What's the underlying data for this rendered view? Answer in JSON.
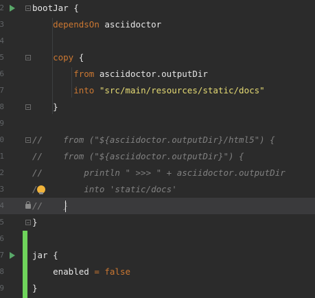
{
  "editor": {
    "lines": [
      {
        "num": "2",
        "parts": [
          {
            "cls": "plain",
            "text": "bootJar {"
          }
        ]
      },
      {
        "num": "3",
        "parts": [
          {
            "cls": "plain",
            "text": "    "
          },
          {
            "cls": "kw",
            "text": "dependsOn"
          },
          {
            "cls": "plain",
            "text": " asciidoctor"
          }
        ]
      },
      {
        "num": "4",
        "parts": []
      },
      {
        "num": "5",
        "parts": [
          {
            "cls": "plain",
            "text": "    "
          },
          {
            "cls": "kw",
            "text": "copy"
          },
          {
            "cls": "plain",
            "text": " {"
          }
        ]
      },
      {
        "num": "6",
        "parts": [
          {
            "cls": "plain",
            "text": "        "
          },
          {
            "cls": "kw",
            "text": "from"
          },
          {
            "cls": "plain",
            "text": " asciidoctor.outputDir"
          }
        ]
      },
      {
        "num": "7",
        "parts": [
          {
            "cls": "plain",
            "text": "        "
          },
          {
            "cls": "kw",
            "text": "into"
          },
          {
            "cls": "plain",
            "text": " "
          },
          {
            "cls": "strong-str",
            "text": "\"src/main/resources/static/docs\""
          }
        ]
      },
      {
        "num": "8",
        "parts": [
          {
            "cls": "plain",
            "text": "    }"
          }
        ]
      },
      {
        "num": "9",
        "parts": []
      },
      {
        "num": "0",
        "parts": [
          {
            "cls": "cmt",
            "text": "//    from (\"${asciidoctor.outputDir}/html5\") {"
          }
        ]
      },
      {
        "num": "1",
        "parts": [
          {
            "cls": "cmt",
            "text": "//    from (\"${asciidoctor.outputDir}\") {"
          }
        ]
      },
      {
        "num": "2",
        "parts": [
          {
            "cls": "cmt",
            "text": "//        println \" >>> \" + asciidoctor.outputDir"
          }
        ]
      },
      {
        "num": "3",
        "parts": [
          {
            "cls": "cmt",
            "text": "/         into 'static/docs'"
          }
        ]
      },
      {
        "num": "4",
        "parts": [
          {
            "cls": "cmt",
            "text": "//    }"
          }
        ]
      },
      {
        "num": "5",
        "parts": [
          {
            "cls": "plain",
            "text": "}"
          }
        ]
      },
      {
        "num": "6",
        "parts": []
      },
      {
        "num": "7",
        "parts": [
          {
            "cls": "plain",
            "text": "jar {"
          }
        ]
      },
      {
        "num": "8",
        "parts": [
          {
            "cls": "plain",
            "text": "    enabled "
          },
          {
            "cls": "kw",
            "text": "="
          },
          {
            "cls": "plain",
            "text": " "
          },
          {
            "cls": "bool",
            "text": "false"
          }
        ]
      },
      {
        "num": "9",
        "parts": [
          {
            "cls": "plain",
            "text": "}"
          }
        ]
      }
    ]
  },
  "colors": {
    "background": "#2b2b2b",
    "current_line": "#3a3a3c",
    "keyword": "#cc7832",
    "string": "#e6db74",
    "comment": "#808080",
    "run_icon": "#59a869",
    "vcs_added": "#6fd45b"
  }
}
